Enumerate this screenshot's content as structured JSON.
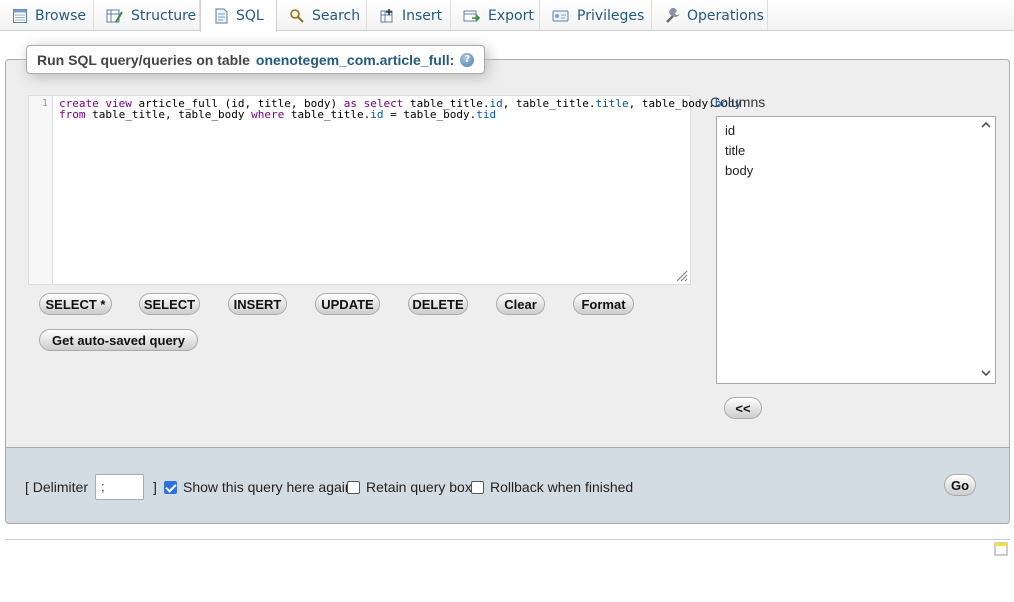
{
  "tabs": [
    {
      "label": "Browse",
      "icon": "browse-icon"
    },
    {
      "label": "Structure",
      "icon": "structure-icon"
    },
    {
      "label": "SQL",
      "icon": "sql-icon",
      "active": true
    },
    {
      "label": "Search",
      "icon": "search-icon"
    },
    {
      "label": "Insert",
      "icon": "insert-icon"
    },
    {
      "label": "Export",
      "icon": "export-icon"
    },
    {
      "label": "Privileges",
      "icon": "privileges-icon"
    },
    {
      "label": "Operations",
      "icon": "operations-icon"
    }
  ],
  "legend": {
    "prefix": "Run SQL query/queries on table",
    "table": "onenotegem_com.article_full:",
    "help_icon": "help-icon"
  },
  "editor": {
    "line_number": "1",
    "line1": [
      {
        "t": "create",
        "c": "kw"
      },
      {
        "t": " ",
        "c": ""
      },
      {
        "t": "view",
        "c": "kw"
      },
      {
        "t": " article_full (id, title, body) ",
        "c": ""
      },
      {
        "t": "as",
        "c": "kw"
      },
      {
        "t": " ",
        "c": ""
      },
      {
        "t": "select",
        "c": "kw"
      },
      {
        "t": " table_title.",
        "c": ""
      },
      {
        "t": "id",
        "c": "prop"
      },
      {
        "t": ", table_title.",
        "c": ""
      },
      {
        "t": "title",
        "c": "prop"
      },
      {
        "t": ", table_body.",
        "c": ""
      },
      {
        "t": "body",
        "c": "prop"
      }
    ],
    "line2": [
      {
        "t": "from",
        "c": "kw"
      },
      {
        "t": " table_title, table_body ",
        "c": ""
      },
      {
        "t": "where",
        "c": "kw"
      },
      {
        "t": " table_title.",
        "c": ""
      },
      {
        "t": "id",
        "c": "prop"
      },
      {
        "t": " = table_body.",
        "c": ""
      },
      {
        "t": "tid",
        "c": "prop"
      }
    ]
  },
  "buttons": {
    "select_all": "SELECT *",
    "select": "SELECT",
    "insert": "INSERT",
    "update": "UPDATE",
    "delete": "DELETE",
    "clear": "Clear",
    "format": "Format",
    "auto_saved": "Get auto-saved query",
    "insert_columns": "<<",
    "go": "Go"
  },
  "columns": {
    "label": "Columns",
    "items": [
      "id",
      "title",
      "body"
    ]
  },
  "options": {
    "delimiter_open": "[ Delimiter",
    "delimiter_value": ";",
    "delimiter_close": "]",
    "show_query": {
      "label": "Show this query here again",
      "checked": true
    },
    "retain_box": {
      "label": "Retain query box",
      "checked": false
    },
    "rollback": {
      "label": "Rollback when finished",
      "checked": false
    }
  },
  "colors": {
    "link": "#235a81",
    "checkbox_checked": "#2f73d9"
  }
}
